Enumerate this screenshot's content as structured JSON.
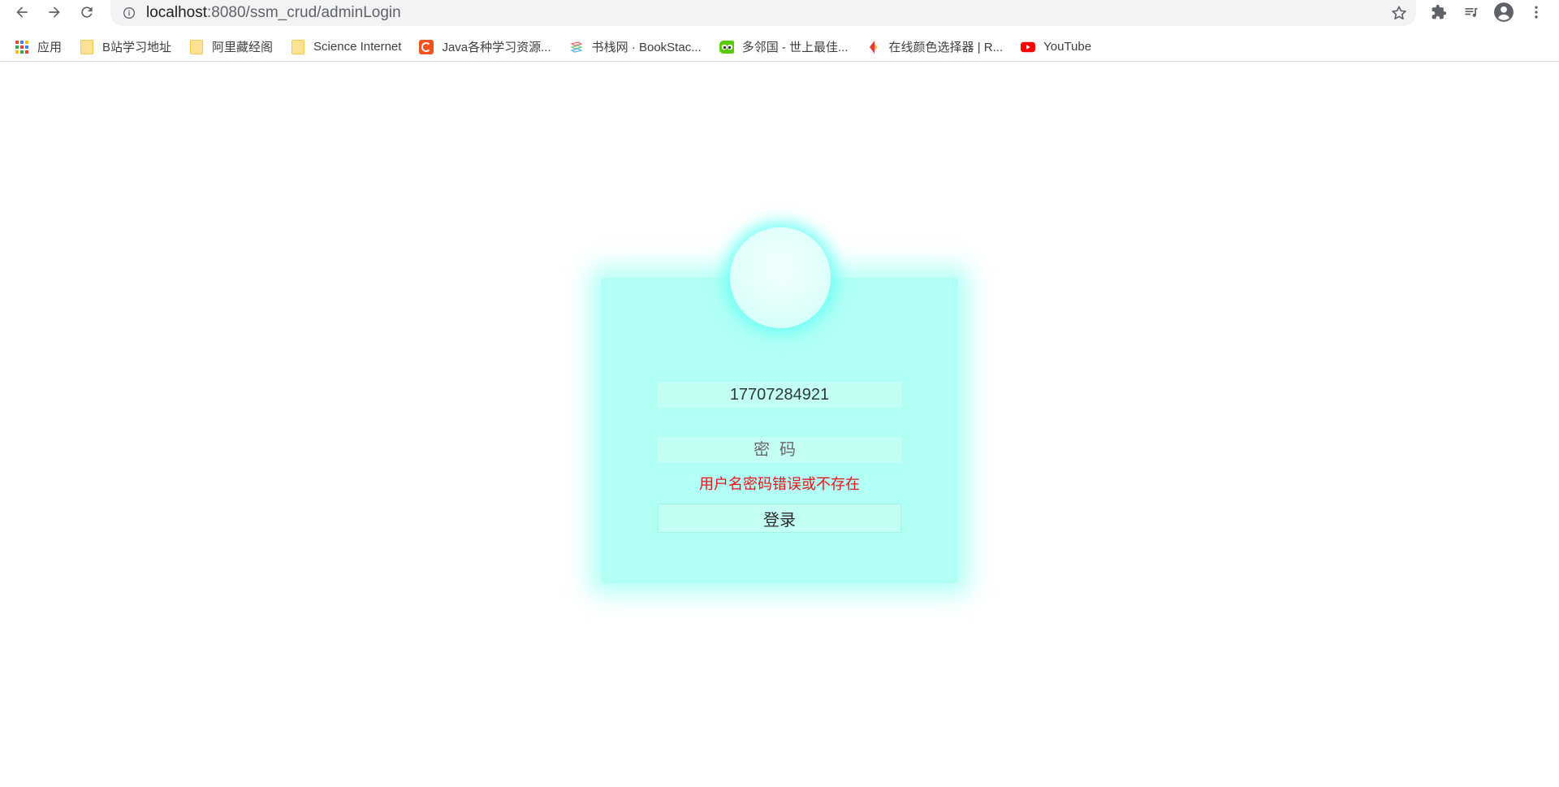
{
  "browser": {
    "url_host": "localhost",
    "url_path": ":8080/ssm_crud/adminLogin",
    "bookmarks": [
      {
        "label": "应用",
        "icon": "apps-grid-icon"
      },
      {
        "label": "B站学习地址",
        "icon": "folder-icon"
      },
      {
        "label": "阿里藏经阁",
        "icon": "folder-icon"
      },
      {
        "label": "Science Internet",
        "icon": "folder-icon"
      },
      {
        "label": "Java各种学习资源...",
        "icon": "c-logo-icon"
      },
      {
        "label": "书栈网 · BookStac...",
        "icon": "bookstack-icon"
      },
      {
        "label": "多邻国 - 世上最佳...",
        "icon": "duolingo-owl-icon"
      },
      {
        "label": "在线颜色选择器 | R...",
        "icon": "color-picker-icon"
      },
      {
        "label": "YouTube",
        "icon": "youtube-icon"
      }
    ]
  },
  "login": {
    "username_value": "17707284921",
    "password_placeholder": "密码",
    "error_message": "用户名密码错误或不存在",
    "submit_label": "登录"
  },
  "colors": {
    "card_bg": "#b1fff5",
    "error": "#e8141a",
    "youtube": "#ff0000"
  }
}
